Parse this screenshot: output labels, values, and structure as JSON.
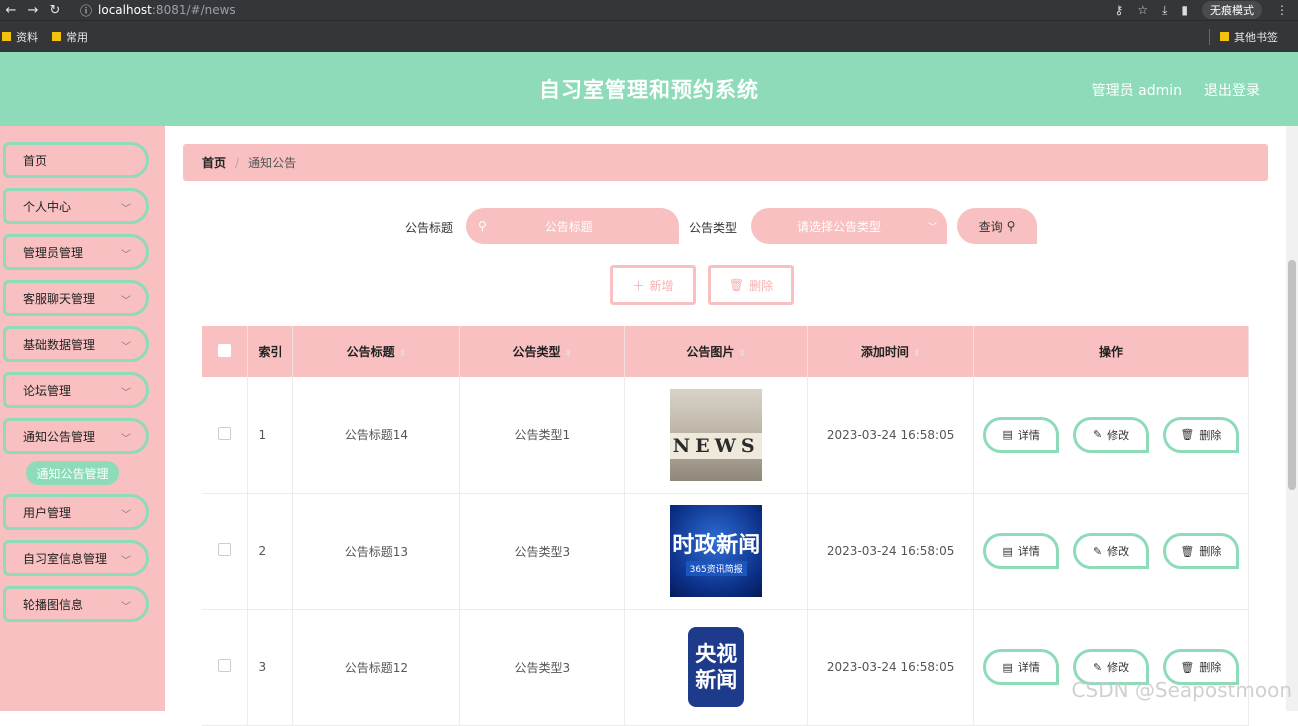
{
  "browser": {
    "url_icon": "ⓘ",
    "url_host": "localhost",
    "url_path": ":8081/#/news",
    "incognito_label": "无痕模式",
    "bookmarks": [
      "资料",
      "常用"
    ],
    "other_bookmarks": "其他书签"
  },
  "header": {
    "title": "自习室管理和预约系统",
    "admin_label": "管理员 admin",
    "logout_label": "退出登录"
  },
  "sidebar": {
    "items": [
      {
        "label": "首页"
      },
      {
        "label": "个人中心"
      },
      {
        "label": "管理员管理"
      },
      {
        "label": "客服聊天管理"
      },
      {
        "label": "基础数据管理"
      },
      {
        "label": "论坛管理"
      },
      {
        "label": "通知公告管理"
      },
      {
        "label": "用户管理"
      },
      {
        "label": "自习室信息管理"
      },
      {
        "label": "轮播图信息"
      }
    ],
    "active_sub": "通知公告管理"
  },
  "breadcrumb": {
    "home": "首页",
    "separator": "/",
    "current": "通知公告"
  },
  "search": {
    "title_label": "公告标题",
    "title_placeholder": "公告标题",
    "type_label": "公告类型",
    "type_placeholder": "请选择公告类型",
    "query_label": "查询"
  },
  "actions": {
    "add_label": "新增",
    "delete_label": "删除"
  },
  "table": {
    "headers": [
      "索引",
      "公告标题",
      "公告类型",
      "公告图片",
      "添加时间",
      "操作"
    ],
    "rows": [
      {
        "index": "1",
        "title": "公告标题14",
        "type": "公告类型1",
        "image_text": "NEWS",
        "time": "2023-03-24 16:58:05"
      },
      {
        "index": "2",
        "title": "公告标题13",
        "type": "公告类型3",
        "image_text": "时政新闻",
        "image_sub": "365资讯简报",
        "time": "2023-03-24 16:58:05"
      },
      {
        "index": "3",
        "title": "公告标题12",
        "type": "公告类型3",
        "image_text": "央视新闻",
        "time": "2023-03-24 16:58:05"
      }
    ],
    "op_labels": {
      "detail": "详情",
      "edit": "修改",
      "delete": "删除"
    }
  },
  "watermark": "CSDN @Seapostmoon",
  "colors": {
    "accent_green": "#8ddbb9",
    "accent_pink": "#f8c0c0"
  }
}
